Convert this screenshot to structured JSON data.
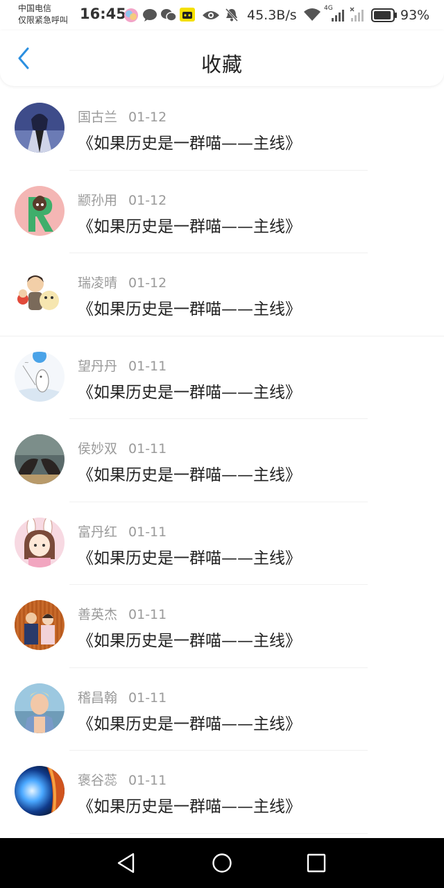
{
  "status_bar": {
    "carrier_line1": "中国电信",
    "carrier_line2": "仅限紧急呼叫",
    "time": "16:45",
    "net_speed": "45.3B/s",
    "signal_tag": "4G",
    "battery": "93%",
    "battery_level": 0.93
  },
  "header": {
    "title": "收藏",
    "accent_color": "#2b8fe0"
  },
  "favorites": [
    {
      "name": "国古兰",
      "date": "01-12",
      "title": "《如果历史是一群喵——主线》"
    },
    {
      "name": "颛孙用",
      "date": "01-12",
      "title": "《如果历史是一群喵——主线》"
    },
    {
      "name": "瑞凌晴",
      "date": "01-12",
      "title": "《如果历史是一群喵——主线》"
    },
    {
      "name": "望丹丹",
      "date": "01-11",
      "title": "《如果历史是一群喵——主线》"
    },
    {
      "name": "侯妙双",
      "date": "01-11",
      "title": "《如果历史是一群喵——主线》"
    },
    {
      "name": "富丹红",
      "date": "01-11",
      "title": "《如果历史是一群喵——主线》"
    },
    {
      "name": "善英杰",
      "date": "01-11",
      "title": "《如果历史是一群喵——主线》"
    },
    {
      "name": "稽昌翰",
      "date": "01-11",
      "title": "《如果历史是一群喵——主线》"
    },
    {
      "name": "褒谷蕊",
      "date": "01-11",
      "title": "《如果历史是一群喵——主线》"
    }
  ],
  "nav_bar": {
    "back": "back-triangle-icon",
    "home": "home-circle-icon",
    "recents": "recents-square-icon"
  }
}
